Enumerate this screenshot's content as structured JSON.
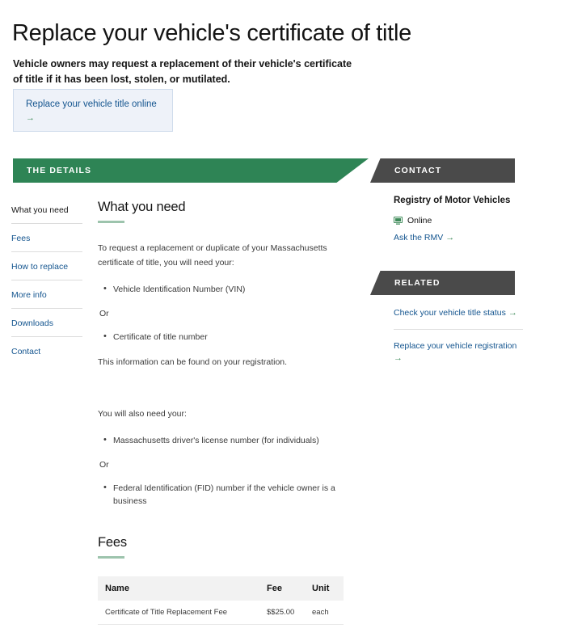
{
  "page": {
    "title": "Replace your vehicle's certificate of title",
    "intro": "Vehicle owners may request a replacement of their vehicle's certificate of title if it has been lost, stolen, or mutilated."
  },
  "cta": {
    "label": "Replace your vehicle title online",
    "arrow": "→"
  },
  "banners": {
    "details": "THE DETAILS",
    "contact": "CONTACT",
    "related": "RELATED"
  },
  "sidenav": {
    "items": [
      {
        "label": "What you need",
        "active": true
      },
      {
        "label": "Fees",
        "active": false
      },
      {
        "label": "How to replace",
        "active": false
      },
      {
        "label": "More info",
        "active": false
      },
      {
        "label": "Downloads",
        "active": false
      },
      {
        "label": "Contact",
        "active": false
      }
    ]
  },
  "what_you_need": {
    "heading": "What you need",
    "paragraph_1": "To request a replacement or duplicate of your Massachusetts certificate of title, you will need your:",
    "bullet_1": "Vehicle Identification Number (VIN)",
    "or_1": "Or",
    "bullet_2": "Certificate of title number",
    "paragraph_2": "This information can be found on your registration.",
    "paragraph_3": "You will also need your:",
    "bullet_3": "Massachusetts driver's license number (for individuals)",
    "or_2": "Or",
    "bullet_4": "Federal Identification (FID) number if the vehicle owner is a business"
  },
  "fees": {
    "heading": "Fees",
    "columns": [
      "Name",
      "Fee",
      "Unit"
    ],
    "rows": [
      {
        "name": "Certificate of Title Replacement Fee",
        "fee": "$$25.00",
        "unit": "each"
      }
    ]
  },
  "contact": {
    "org": "Registry of Motor Vehicles",
    "online_label": "Online",
    "link_label": "Ask the RMV",
    "arrow": "→"
  },
  "related": {
    "items": [
      {
        "label": "Check your vehicle title status",
        "arrow": "→"
      },
      {
        "label": "Replace your vehicle registration",
        "arrow": "→"
      }
    ]
  },
  "colors": {
    "green": "#2e8455",
    "dark_gray": "#4a4a4a",
    "link_blue": "#14558f",
    "arrow_green": "#3d8a58",
    "cta_bg": "#eef2f9"
  }
}
